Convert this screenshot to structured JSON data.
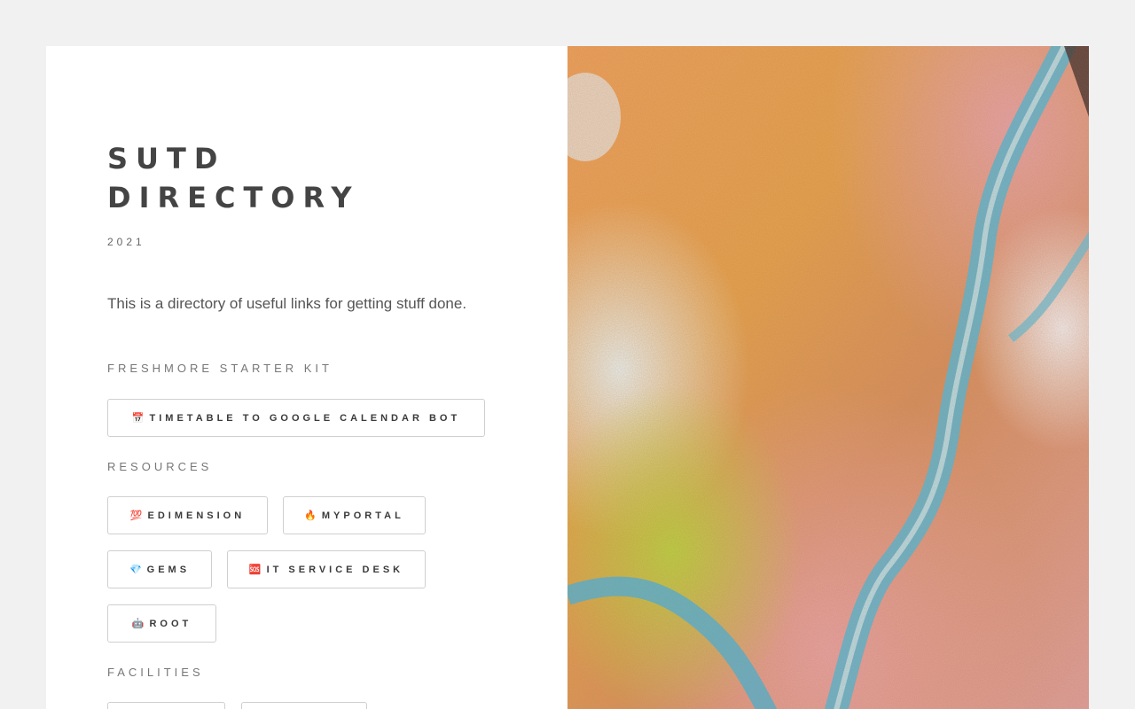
{
  "header": {
    "title_line1": "SUTD",
    "title_line2": "DIRECTORY",
    "year": "2021"
  },
  "intro": "This is a directory of useful links for getting stuff done.",
  "sections": {
    "freshmore": {
      "heading": "FRESHMORE STARTER KIT",
      "buttons": [
        {
          "icon": "📅",
          "label": "TIMETABLE TO GOOGLE CALENDAR BOT"
        }
      ]
    },
    "resources": {
      "heading": "RESOURCES",
      "buttons": [
        {
          "icon": "💯",
          "label": "EDIMENSION"
        },
        {
          "icon": "🔥",
          "label": "MYPORTAL"
        },
        {
          "icon": "💎",
          "label": "GEMS"
        },
        {
          "icon": "🆘",
          "label": "IT SERVICE DESK"
        },
        {
          "icon": "🤖",
          "label": "ROOT"
        }
      ]
    },
    "facilities": {
      "heading": "FACILITIES"
    }
  },
  "colors": {
    "background": "#f1f1f1",
    "card": "#ffffff",
    "title": "#444444",
    "button_border": "#cfcfcf"
  },
  "hero_image": {
    "icon": "aerial-landscape-image"
  }
}
